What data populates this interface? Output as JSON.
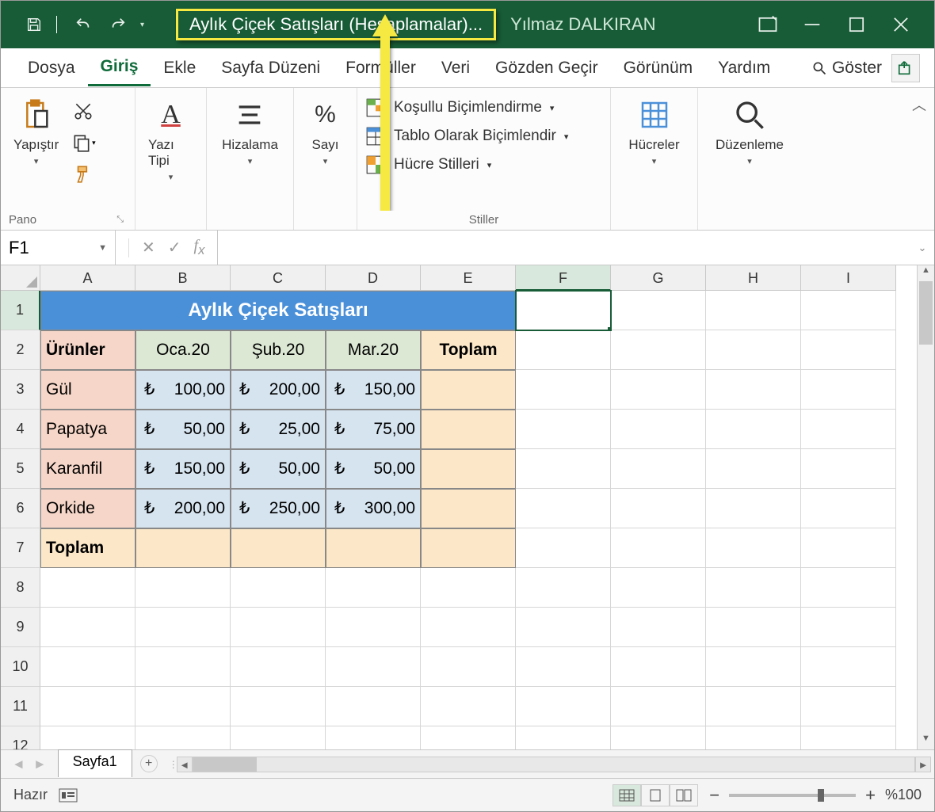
{
  "titlebar": {
    "doc_title": "Aylık Çiçek Satışları (Hesaplamalar)...",
    "user_name": "Yılmaz DALKIRAN"
  },
  "ribbon": {
    "tabs": [
      "Dosya",
      "Giriş",
      "Ekle",
      "Sayfa Düzeni",
      "Formüller",
      "Veri",
      "Gözden Geçir",
      "Görünüm",
      "Yardım"
    ],
    "active_index": 1,
    "search_label": "Göster",
    "groups": {
      "pano": {
        "label": "Pano",
        "paste": "Yapıştır"
      },
      "font": {
        "label": "Yazı Tipi"
      },
      "align": {
        "label": "Hizalama"
      },
      "number": {
        "label": "Sayı"
      },
      "styles": {
        "label": "Stiller",
        "cond": "Koşullu Biçimlendirme",
        "as_table": "Tablo Olarak Biçimlendir",
        "cell_styles": "Hücre Stilleri"
      },
      "cells": {
        "label": "Hücreler"
      },
      "editing": {
        "label": "Düzenleme"
      }
    }
  },
  "formula_bar": {
    "name_box": "F1",
    "formula": ""
  },
  "grid": {
    "columns": [
      "A",
      "B",
      "C",
      "D",
      "E",
      "F",
      "G",
      "H",
      "I"
    ],
    "rows": [
      "1",
      "2",
      "3",
      "4",
      "5",
      "6",
      "7",
      "8",
      "9",
      "10",
      "11",
      "12"
    ],
    "selected_col": "F",
    "selected_row": "1",
    "title_merged": "Aylık Çiçek Satışları",
    "headers": {
      "products": "Ürünler",
      "months": [
        "Oca.20",
        "Şub.20",
        "Mar.20"
      ],
      "total": "Toplam"
    },
    "data": [
      {
        "name": "Gül",
        "vals": [
          "100,00",
          "200,00",
          "150,00"
        ]
      },
      {
        "name": "Papatya",
        "vals": [
          "50,00",
          "25,00",
          "75,00"
        ]
      },
      {
        "name": "Karanfil",
        "vals": [
          "150,00",
          "50,00",
          "50,00"
        ]
      },
      {
        "name": "Orkide",
        "vals": [
          "200,00",
          "250,00",
          "300,00"
        ]
      }
    ],
    "currency": "₺",
    "total_row_label": "Toplam"
  },
  "sheets": {
    "tabs": [
      "Sayfa1"
    ],
    "active": 0
  },
  "status": {
    "ready": "Hazır",
    "zoom": "%100"
  }
}
